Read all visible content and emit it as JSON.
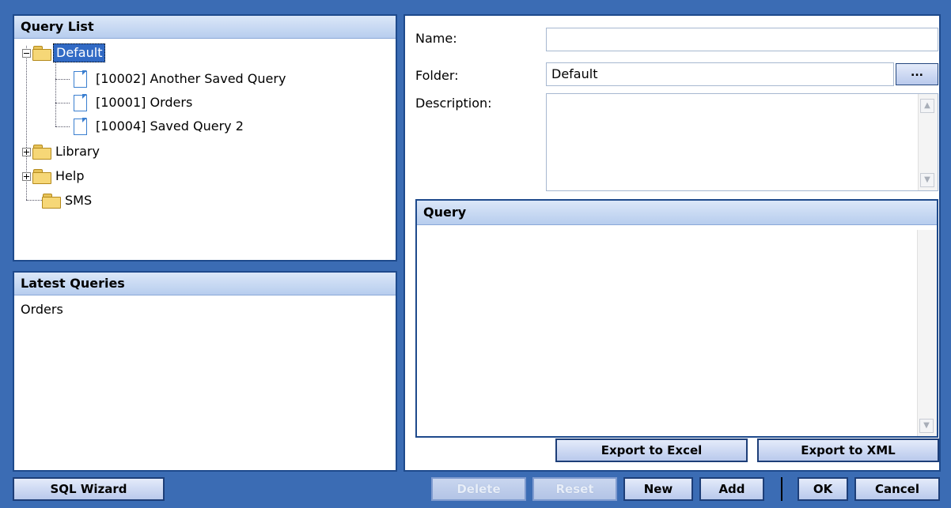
{
  "query_list": {
    "title": "Query List",
    "tree": [
      {
        "label": "Default",
        "expanded": true,
        "selected": true,
        "children": [
          "[10002] Another Saved Query",
          "[10001] Orders",
          "[10004] Saved Query 2"
        ]
      },
      {
        "label": "Library",
        "expanded": false
      },
      {
        "label": "Help",
        "expanded": false
      },
      {
        "label": "SMS",
        "expanded": false
      }
    ]
  },
  "latest_queries": {
    "title": "Latest Queries",
    "items": [
      "Orders"
    ]
  },
  "form": {
    "name_label": "Name:",
    "name_value": "",
    "folder_label": "Folder:",
    "folder_value": "Default",
    "browse_label": "...",
    "description_label": "Description:",
    "description_value": ""
  },
  "query": {
    "title": "Query",
    "text": ""
  },
  "buttons": {
    "export_excel": "Export to Excel",
    "export_xml": "Export to XML",
    "sql_wizard": "SQL Wizard",
    "delete": "Delete",
    "reset": "Reset",
    "new": "New",
    "add": "Add",
    "ok": "OK",
    "cancel": "Cancel"
  },
  "icons": {
    "folder": "folder-icon",
    "document": "document-icon",
    "scroll_up": "chevron-up-icon",
    "scroll_down": "chevron-down-icon"
  }
}
